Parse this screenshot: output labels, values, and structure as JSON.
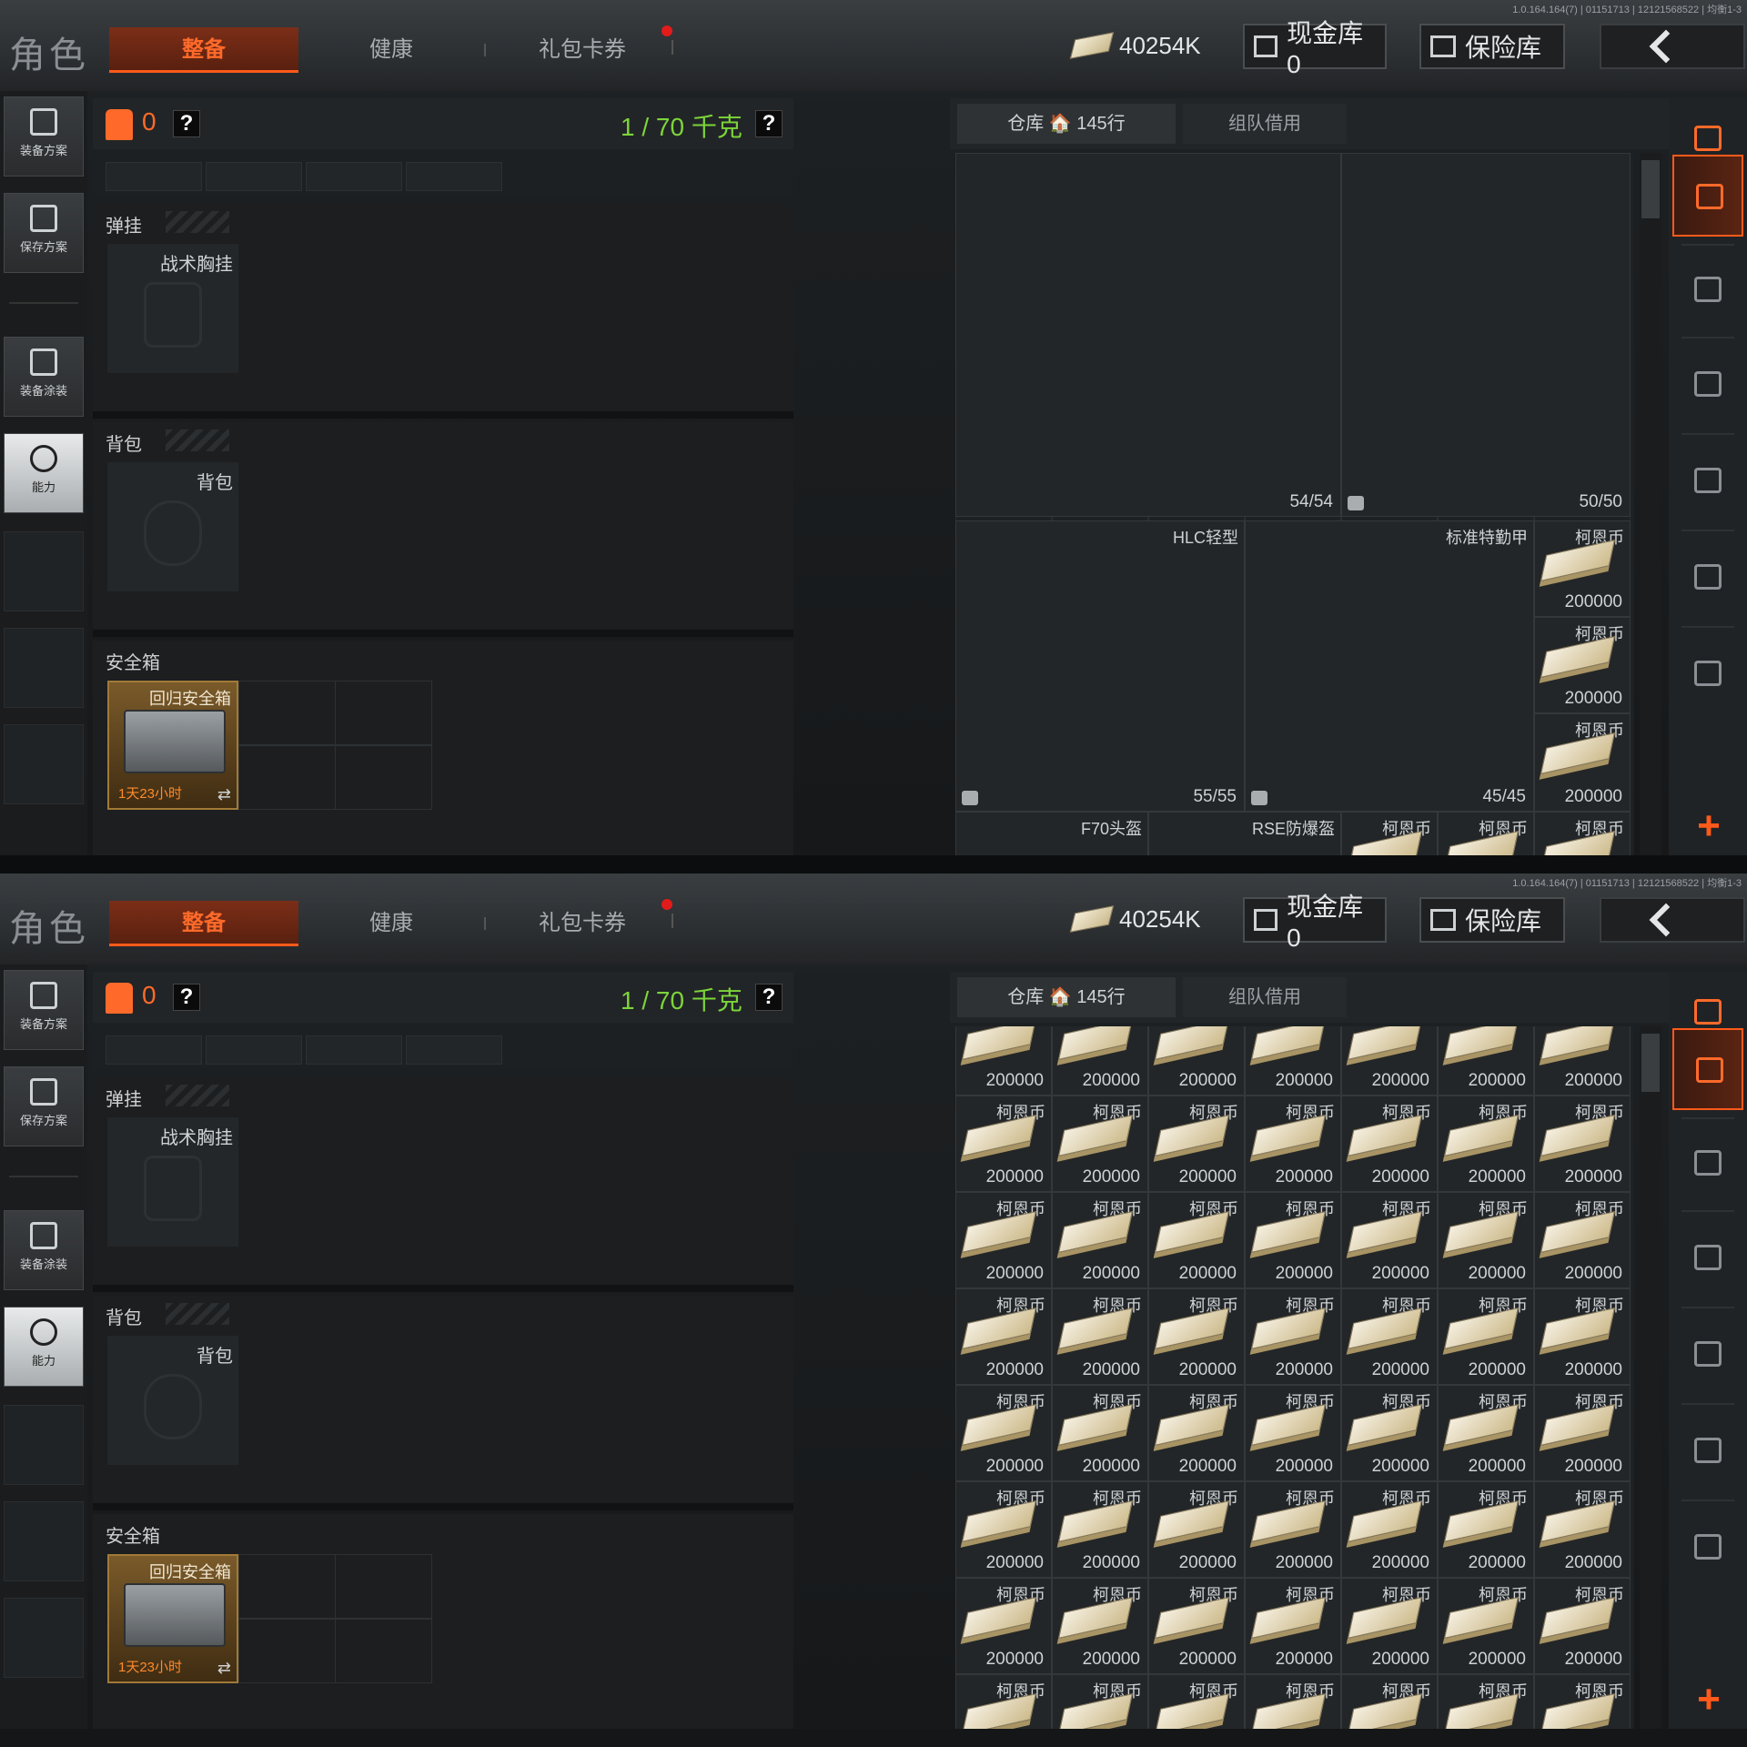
{
  "version": "1.0.164.164(7) | 01151713 | 12121568522 | 均衡1-3",
  "topbar": {
    "title": "角色",
    "tabs": [
      {
        "label": "整备",
        "active": true
      },
      {
        "label": "健康"
      },
      {
        "label": "礼包卡券",
        "has_notification": true
      }
    ],
    "currency_amount": "40254K",
    "cash_vault_label": "现金库 0",
    "insurance_label": "保险库"
  },
  "left_sidebar": {
    "buttons": [
      {
        "label": "装备方案"
      },
      {
        "label": "保存方案"
      },
      {
        "label": "装备涂装"
      },
      {
        "label": "能力",
        "active": true
      }
    ]
  },
  "equipment": {
    "armor_value": "0",
    "help_label": "?",
    "weight": "1 / 70 千克",
    "rig": {
      "section": "弹挂",
      "slot": "战术胸挂"
    },
    "backpack": {
      "section": "背包",
      "slot": "背包"
    },
    "safe": {
      "section": "安全箱",
      "name": "回归安全箱",
      "timer": "1天23小时",
      "swap": "⇄"
    }
  },
  "warehouse": {
    "tabs": [
      {
        "label": "仓库 🏠 145行",
        "active": true
      },
      {
        "label": "组队借用"
      }
    ],
    "screen1_items": [
      {
        "name": "",
        "count": "54/54",
        "kind": "heavy-vest"
      },
      {
        "name": "",
        "count": "50/50",
        "kind": "grey-vest"
      },
      {
        "name": "HLC轻型",
        "count": "55/55",
        "kind": "tan-vest"
      },
      {
        "name": "标准特勤甲",
        "count": "45/45",
        "kind": "black-vest"
      }
    ],
    "screen1_partial": [
      "F70头盔",
      "RSE防爆盔"
    ],
    "cash_item": {
      "name": "柯恩币",
      "value": "200000"
    }
  },
  "colors": {
    "accent": "#ff5a1a",
    "weight_green": "#7cd53a"
  }
}
